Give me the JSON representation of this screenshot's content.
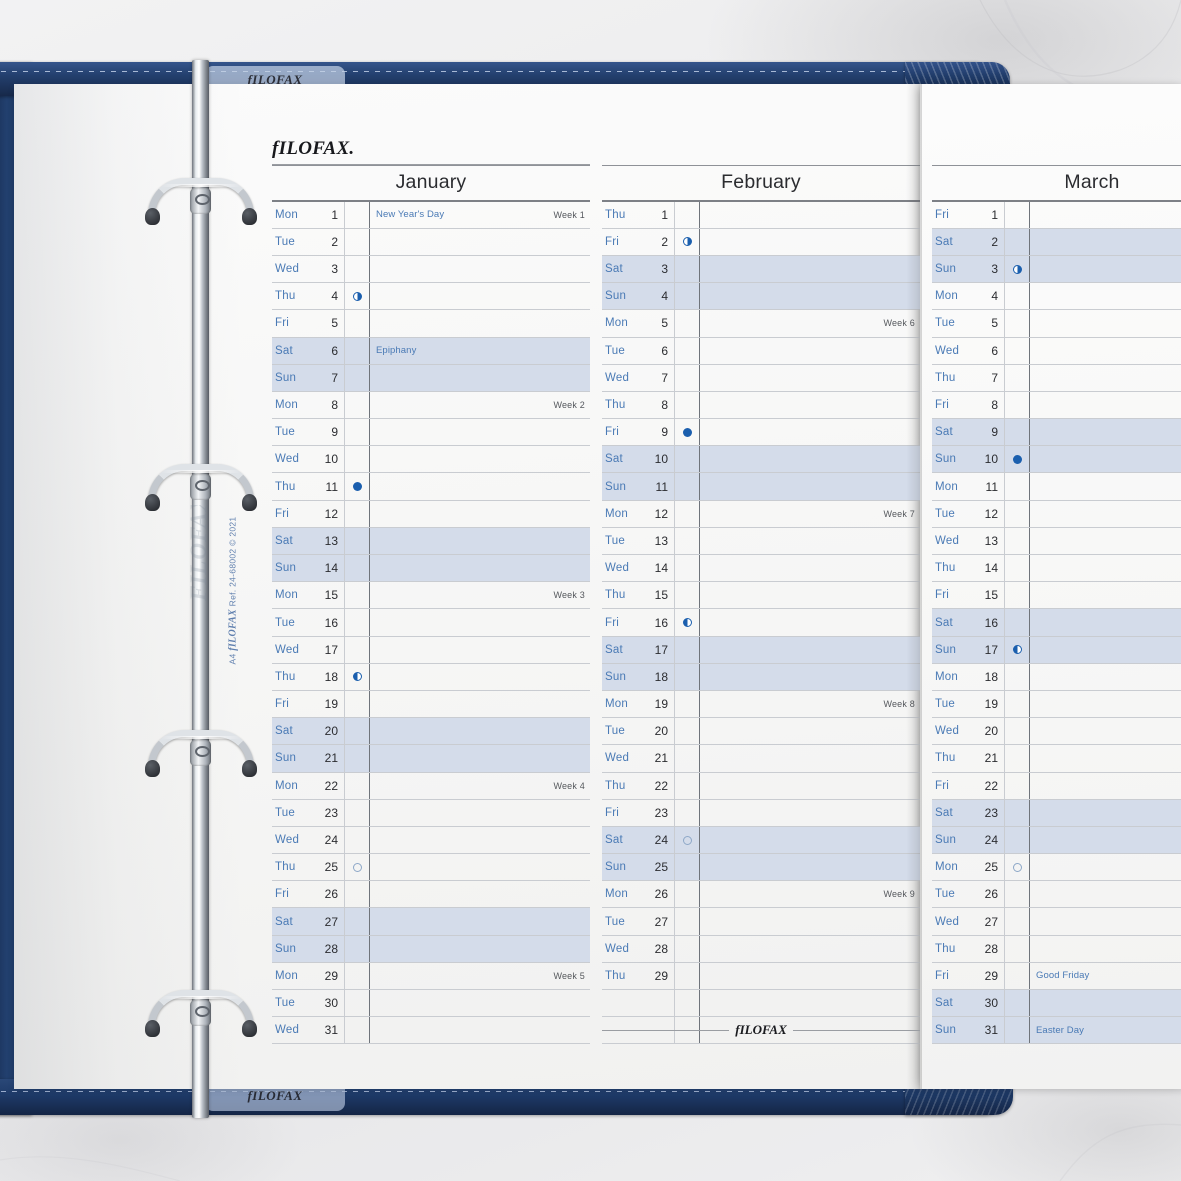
{
  "product": {
    "brand": "fILOFAX.",
    "brand_footer": "fILOFAX",
    "brand_tab": "fILOFAX",
    "spine_size": "A4",
    "spine_logo": "fILOFAX",
    "spine_ref": "Ref. 24-68002 © 2021",
    "ghost_text": "FILOFAX"
  },
  "colors": {
    "day_blue": "#4a7ab5",
    "weekend_shade": "#d4dcea",
    "moon_blue": "#1b5fae",
    "leather_navy": "#203a66",
    "text_dark": "#2b2c30"
  },
  "months": [
    {
      "name": "January",
      "days": [
        {
          "dow": "Mon",
          "num": "1",
          "weekend": false,
          "moon": "",
          "note": "New Year's Day",
          "week": "Week 1"
        },
        {
          "dow": "Tue",
          "num": "2",
          "weekend": false,
          "moon": "",
          "note": "",
          "week": ""
        },
        {
          "dow": "Wed",
          "num": "3",
          "weekend": false,
          "moon": "",
          "note": "",
          "week": ""
        },
        {
          "dow": "Thu",
          "num": "4",
          "weekend": false,
          "moon": "last",
          "note": "",
          "week": ""
        },
        {
          "dow": "Fri",
          "num": "5",
          "weekend": false,
          "moon": "",
          "note": "",
          "week": ""
        },
        {
          "dow": "Sat",
          "num": "6",
          "weekend": true,
          "moon": "",
          "note": "Epiphany",
          "week": ""
        },
        {
          "dow": "Sun",
          "num": "7",
          "weekend": true,
          "moon": "",
          "note": "",
          "week": ""
        },
        {
          "dow": "Mon",
          "num": "8",
          "weekend": false,
          "moon": "",
          "note": "",
          "week": "Week 2"
        },
        {
          "dow": "Tue",
          "num": "9",
          "weekend": false,
          "moon": "",
          "note": "",
          "week": ""
        },
        {
          "dow": "Wed",
          "num": "10",
          "weekend": false,
          "moon": "",
          "note": "",
          "week": ""
        },
        {
          "dow": "Thu",
          "num": "11",
          "weekend": false,
          "moon": "new",
          "note": "",
          "week": ""
        },
        {
          "dow": "Fri",
          "num": "12",
          "weekend": false,
          "moon": "",
          "note": "",
          "week": ""
        },
        {
          "dow": "Sat",
          "num": "13",
          "weekend": true,
          "moon": "",
          "note": "",
          "week": ""
        },
        {
          "dow": "Sun",
          "num": "14",
          "weekend": true,
          "moon": "",
          "note": "",
          "week": ""
        },
        {
          "dow": "Mon",
          "num": "15",
          "weekend": false,
          "moon": "",
          "note": "",
          "week": "Week 3"
        },
        {
          "dow": "Tue",
          "num": "16",
          "weekend": false,
          "moon": "",
          "note": "",
          "week": ""
        },
        {
          "dow": "Wed",
          "num": "17",
          "weekend": false,
          "moon": "",
          "note": "",
          "week": ""
        },
        {
          "dow": "Thu",
          "num": "18",
          "weekend": false,
          "moon": "first",
          "note": "",
          "week": ""
        },
        {
          "dow": "Fri",
          "num": "19",
          "weekend": false,
          "moon": "",
          "note": "",
          "week": ""
        },
        {
          "dow": "Sat",
          "num": "20",
          "weekend": true,
          "moon": "",
          "note": "",
          "week": ""
        },
        {
          "dow": "Sun",
          "num": "21",
          "weekend": true,
          "moon": "",
          "note": "",
          "week": ""
        },
        {
          "dow": "Mon",
          "num": "22",
          "weekend": false,
          "moon": "",
          "note": "",
          "week": "Week 4"
        },
        {
          "dow": "Tue",
          "num": "23",
          "weekend": false,
          "moon": "",
          "note": "",
          "week": ""
        },
        {
          "dow": "Wed",
          "num": "24",
          "weekend": false,
          "moon": "",
          "note": "",
          "week": ""
        },
        {
          "dow": "Thu",
          "num": "25",
          "weekend": false,
          "moon": "full",
          "note": "",
          "week": ""
        },
        {
          "dow": "Fri",
          "num": "26",
          "weekend": false,
          "moon": "",
          "note": "",
          "week": ""
        },
        {
          "dow": "Sat",
          "num": "27",
          "weekend": true,
          "moon": "",
          "note": "",
          "week": ""
        },
        {
          "dow": "Sun",
          "num": "28",
          "weekend": true,
          "moon": "",
          "note": "",
          "week": ""
        },
        {
          "dow": "Mon",
          "num": "29",
          "weekend": false,
          "moon": "",
          "note": "",
          "week": "Week 5"
        },
        {
          "dow": "Tue",
          "num": "30",
          "weekend": false,
          "moon": "",
          "note": "",
          "week": ""
        },
        {
          "dow": "Wed",
          "num": "31",
          "weekend": false,
          "moon": "",
          "note": "",
          "week": ""
        }
      ]
    },
    {
      "name": "February",
      "days": [
        {
          "dow": "Thu",
          "num": "1",
          "weekend": false,
          "moon": "",
          "note": "",
          "week": ""
        },
        {
          "dow": "Fri",
          "num": "2",
          "weekend": false,
          "moon": "last",
          "note": "",
          "week": ""
        },
        {
          "dow": "Sat",
          "num": "3",
          "weekend": true,
          "moon": "",
          "note": "",
          "week": ""
        },
        {
          "dow": "Sun",
          "num": "4",
          "weekend": true,
          "moon": "",
          "note": "",
          "week": ""
        },
        {
          "dow": "Mon",
          "num": "5",
          "weekend": false,
          "moon": "",
          "note": "",
          "week": "Week 6"
        },
        {
          "dow": "Tue",
          "num": "6",
          "weekend": false,
          "moon": "",
          "note": "",
          "week": ""
        },
        {
          "dow": "Wed",
          "num": "7",
          "weekend": false,
          "moon": "",
          "note": "",
          "week": ""
        },
        {
          "dow": "Thu",
          "num": "8",
          "weekend": false,
          "moon": "",
          "note": "",
          "week": ""
        },
        {
          "dow": "Fri",
          "num": "9",
          "weekend": false,
          "moon": "new",
          "note": "",
          "week": ""
        },
        {
          "dow": "Sat",
          "num": "10",
          "weekend": true,
          "moon": "",
          "note": "",
          "week": ""
        },
        {
          "dow": "Sun",
          "num": "11",
          "weekend": true,
          "moon": "",
          "note": "",
          "week": ""
        },
        {
          "dow": "Mon",
          "num": "12",
          "weekend": false,
          "moon": "",
          "note": "",
          "week": "Week 7"
        },
        {
          "dow": "Tue",
          "num": "13",
          "weekend": false,
          "moon": "",
          "note": "",
          "week": ""
        },
        {
          "dow": "Wed",
          "num": "14",
          "weekend": false,
          "moon": "",
          "note": "",
          "week": ""
        },
        {
          "dow": "Thu",
          "num": "15",
          "weekend": false,
          "moon": "",
          "note": "",
          "week": ""
        },
        {
          "dow": "Fri",
          "num": "16",
          "weekend": false,
          "moon": "first",
          "note": "",
          "week": ""
        },
        {
          "dow": "Sat",
          "num": "17",
          "weekend": true,
          "moon": "",
          "note": "",
          "week": ""
        },
        {
          "dow": "Sun",
          "num": "18",
          "weekend": true,
          "moon": "",
          "note": "",
          "week": ""
        },
        {
          "dow": "Mon",
          "num": "19",
          "weekend": false,
          "moon": "",
          "note": "",
          "week": "Week 8"
        },
        {
          "dow": "Tue",
          "num": "20",
          "weekend": false,
          "moon": "",
          "note": "",
          "week": ""
        },
        {
          "dow": "Wed",
          "num": "21",
          "weekend": false,
          "moon": "",
          "note": "",
          "week": ""
        },
        {
          "dow": "Thu",
          "num": "22",
          "weekend": false,
          "moon": "",
          "note": "",
          "week": ""
        },
        {
          "dow": "Fri",
          "num": "23",
          "weekend": false,
          "moon": "",
          "note": "",
          "week": ""
        },
        {
          "dow": "Sat",
          "num": "24",
          "weekend": true,
          "moon": "full",
          "note": "",
          "week": ""
        },
        {
          "dow": "Sun",
          "num": "25",
          "weekend": true,
          "moon": "",
          "note": "",
          "week": ""
        },
        {
          "dow": "Mon",
          "num": "26",
          "weekend": false,
          "moon": "",
          "note": "",
          "week": "Week 9"
        },
        {
          "dow": "Tue",
          "num": "27",
          "weekend": false,
          "moon": "",
          "note": "",
          "week": ""
        },
        {
          "dow": "Wed",
          "num": "28",
          "weekend": false,
          "moon": "",
          "note": "",
          "week": ""
        },
        {
          "dow": "Thu",
          "num": "29",
          "weekend": false,
          "moon": "",
          "note": "",
          "week": ""
        },
        {
          "dow": "",
          "num": "",
          "weekend": false,
          "moon": "",
          "note": "",
          "week": ""
        },
        {
          "dow": "",
          "num": "",
          "weekend": false,
          "moon": "",
          "note": "",
          "week": ""
        }
      ]
    },
    {
      "name": "March",
      "days": [
        {
          "dow": "Fri",
          "num": "1",
          "weekend": false,
          "moon": "",
          "note": "",
          "week": ""
        },
        {
          "dow": "Sat",
          "num": "2",
          "weekend": true,
          "moon": "",
          "note": "",
          "week": ""
        },
        {
          "dow": "Sun",
          "num": "3",
          "weekend": true,
          "moon": "last",
          "note": "",
          "week": ""
        },
        {
          "dow": "Mon",
          "num": "4",
          "weekend": false,
          "moon": "",
          "note": "",
          "week": ""
        },
        {
          "dow": "Tue",
          "num": "5",
          "weekend": false,
          "moon": "",
          "note": "",
          "week": ""
        },
        {
          "dow": "Wed",
          "num": "6",
          "weekend": false,
          "moon": "",
          "note": "",
          "week": ""
        },
        {
          "dow": "Thu",
          "num": "7",
          "weekend": false,
          "moon": "",
          "note": "",
          "week": ""
        },
        {
          "dow": "Fri",
          "num": "8",
          "weekend": false,
          "moon": "",
          "note": "",
          "week": ""
        },
        {
          "dow": "Sat",
          "num": "9",
          "weekend": true,
          "moon": "",
          "note": "",
          "week": ""
        },
        {
          "dow": "Sun",
          "num": "10",
          "weekend": true,
          "moon": "new",
          "note": "",
          "week": ""
        },
        {
          "dow": "Mon",
          "num": "11",
          "weekend": false,
          "moon": "",
          "note": "",
          "week": ""
        },
        {
          "dow": "Tue",
          "num": "12",
          "weekend": false,
          "moon": "",
          "note": "",
          "week": ""
        },
        {
          "dow": "Wed",
          "num": "13",
          "weekend": false,
          "moon": "",
          "note": "",
          "week": ""
        },
        {
          "dow": "Thu",
          "num": "14",
          "weekend": false,
          "moon": "",
          "note": "",
          "week": ""
        },
        {
          "dow": "Fri",
          "num": "15",
          "weekend": false,
          "moon": "",
          "note": "",
          "week": ""
        },
        {
          "dow": "Sat",
          "num": "16",
          "weekend": true,
          "moon": "",
          "note": "",
          "week": ""
        },
        {
          "dow": "Sun",
          "num": "17",
          "weekend": true,
          "moon": "first",
          "note": "",
          "week": ""
        },
        {
          "dow": "Mon",
          "num": "18",
          "weekend": false,
          "moon": "",
          "note": "",
          "week": ""
        },
        {
          "dow": "Tue",
          "num": "19",
          "weekend": false,
          "moon": "",
          "note": "",
          "week": ""
        },
        {
          "dow": "Wed",
          "num": "20",
          "weekend": false,
          "moon": "",
          "note": "",
          "week": ""
        },
        {
          "dow": "Thu",
          "num": "21",
          "weekend": false,
          "moon": "",
          "note": "",
          "week": ""
        },
        {
          "dow": "Fri",
          "num": "22",
          "weekend": false,
          "moon": "",
          "note": "",
          "week": ""
        },
        {
          "dow": "Sat",
          "num": "23",
          "weekend": true,
          "moon": "",
          "note": "",
          "week": ""
        },
        {
          "dow": "Sun",
          "num": "24",
          "weekend": true,
          "moon": "",
          "note": "",
          "week": ""
        },
        {
          "dow": "Mon",
          "num": "25",
          "weekend": false,
          "moon": "full",
          "note": "",
          "week": ""
        },
        {
          "dow": "Tue",
          "num": "26",
          "weekend": false,
          "moon": "",
          "note": "",
          "week": ""
        },
        {
          "dow": "Wed",
          "num": "27",
          "weekend": false,
          "moon": "",
          "note": "",
          "week": ""
        },
        {
          "dow": "Thu",
          "num": "28",
          "weekend": false,
          "moon": "",
          "note": "",
          "week": ""
        },
        {
          "dow": "Fri",
          "num": "29",
          "weekend": false,
          "moon": "",
          "note": "Good Friday",
          "week": ""
        },
        {
          "dow": "Sat",
          "num": "30",
          "weekend": true,
          "moon": "",
          "note": "",
          "week": ""
        },
        {
          "dow": "Sun",
          "num": "31",
          "weekend": true,
          "moon": "",
          "note": "Easter Day",
          "week": ""
        }
      ]
    }
  ]
}
